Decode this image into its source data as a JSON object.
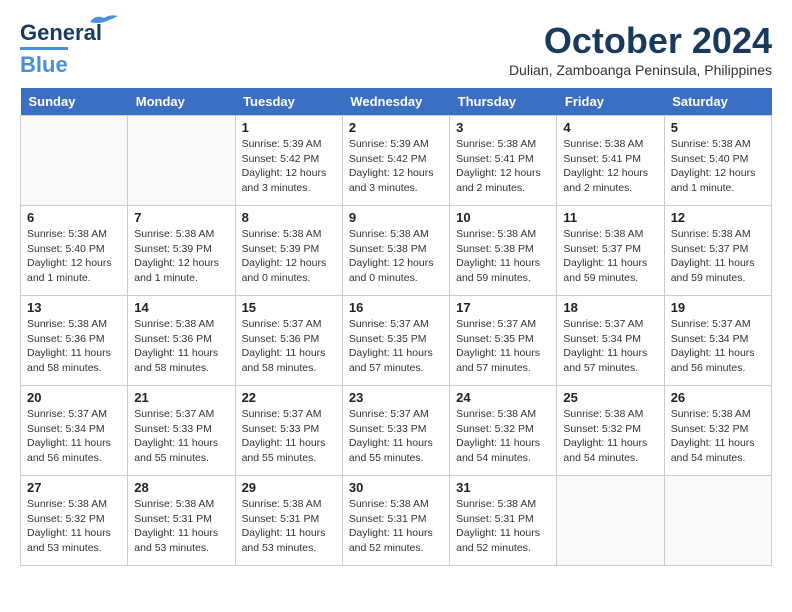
{
  "header": {
    "logo_line1": "General",
    "logo_line2": "Blue",
    "month": "October 2024",
    "location": "Dulian, Zamboanga Peninsula, Philippines"
  },
  "columns": [
    "Sunday",
    "Monday",
    "Tuesday",
    "Wednesday",
    "Thursday",
    "Friday",
    "Saturday"
  ],
  "weeks": [
    [
      {
        "day": "",
        "info": ""
      },
      {
        "day": "",
        "info": ""
      },
      {
        "day": "1",
        "info": "Sunrise: 5:39 AM\nSunset: 5:42 PM\nDaylight: 12 hours\nand 3 minutes."
      },
      {
        "day": "2",
        "info": "Sunrise: 5:39 AM\nSunset: 5:42 PM\nDaylight: 12 hours\nand 3 minutes."
      },
      {
        "day": "3",
        "info": "Sunrise: 5:38 AM\nSunset: 5:41 PM\nDaylight: 12 hours\nand 2 minutes."
      },
      {
        "day": "4",
        "info": "Sunrise: 5:38 AM\nSunset: 5:41 PM\nDaylight: 12 hours\nand 2 minutes."
      },
      {
        "day": "5",
        "info": "Sunrise: 5:38 AM\nSunset: 5:40 PM\nDaylight: 12 hours\nand 1 minute."
      }
    ],
    [
      {
        "day": "6",
        "info": "Sunrise: 5:38 AM\nSunset: 5:40 PM\nDaylight: 12 hours\nand 1 minute."
      },
      {
        "day": "7",
        "info": "Sunrise: 5:38 AM\nSunset: 5:39 PM\nDaylight: 12 hours\nand 1 minute."
      },
      {
        "day": "8",
        "info": "Sunrise: 5:38 AM\nSunset: 5:39 PM\nDaylight: 12 hours\nand 0 minutes."
      },
      {
        "day": "9",
        "info": "Sunrise: 5:38 AM\nSunset: 5:38 PM\nDaylight: 12 hours\nand 0 minutes."
      },
      {
        "day": "10",
        "info": "Sunrise: 5:38 AM\nSunset: 5:38 PM\nDaylight: 11 hours\nand 59 minutes."
      },
      {
        "day": "11",
        "info": "Sunrise: 5:38 AM\nSunset: 5:37 PM\nDaylight: 11 hours\nand 59 minutes."
      },
      {
        "day": "12",
        "info": "Sunrise: 5:38 AM\nSunset: 5:37 PM\nDaylight: 11 hours\nand 59 minutes."
      }
    ],
    [
      {
        "day": "13",
        "info": "Sunrise: 5:38 AM\nSunset: 5:36 PM\nDaylight: 11 hours\nand 58 minutes."
      },
      {
        "day": "14",
        "info": "Sunrise: 5:38 AM\nSunset: 5:36 PM\nDaylight: 11 hours\nand 58 minutes."
      },
      {
        "day": "15",
        "info": "Sunrise: 5:37 AM\nSunset: 5:36 PM\nDaylight: 11 hours\nand 58 minutes."
      },
      {
        "day": "16",
        "info": "Sunrise: 5:37 AM\nSunset: 5:35 PM\nDaylight: 11 hours\nand 57 minutes."
      },
      {
        "day": "17",
        "info": "Sunrise: 5:37 AM\nSunset: 5:35 PM\nDaylight: 11 hours\nand 57 minutes."
      },
      {
        "day": "18",
        "info": "Sunrise: 5:37 AM\nSunset: 5:34 PM\nDaylight: 11 hours\nand 57 minutes."
      },
      {
        "day": "19",
        "info": "Sunrise: 5:37 AM\nSunset: 5:34 PM\nDaylight: 11 hours\nand 56 minutes."
      }
    ],
    [
      {
        "day": "20",
        "info": "Sunrise: 5:37 AM\nSunset: 5:34 PM\nDaylight: 11 hours\nand 56 minutes."
      },
      {
        "day": "21",
        "info": "Sunrise: 5:37 AM\nSunset: 5:33 PM\nDaylight: 11 hours\nand 55 minutes."
      },
      {
        "day": "22",
        "info": "Sunrise: 5:37 AM\nSunset: 5:33 PM\nDaylight: 11 hours\nand 55 minutes."
      },
      {
        "day": "23",
        "info": "Sunrise: 5:37 AM\nSunset: 5:33 PM\nDaylight: 11 hours\nand 55 minutes."
      },
      {
        "day": "24",
        "info": "Sunrise: 5:38 AM\nSunset: 5:32 PM\nDaylight: 11 hours\nand 54 minutes."
      },
      {
        "day": "25",
        "info": "Sunrise: 5:38 AM\nSunset: 5:32 PM\nDaylight: 11 hours\nand 54 minutes."
      },
      {
        "day": "26",
        "info": "Sunrise: 5:38 AM\nSunset: 5:32 PM\nDaylight: 11 hours\nand 54 minutes."
      }
    ],
    [
      {
        "day": "27",
        "info": "Sunrise: 5:38 AM\nSunset: 5:32 PM\nDaylight: 11 hours\nand 53 minutes."
      },
      {
        "day": "28",
        "info": "Sunrise: 5:38 AM\nSunset: 5:31 PM\nDaylight: 11 hours\nand 53 minutes."
      },
      {
        "day": "29",
        "info": "Sunrise: 5:38 AM\nSunset: 5:31 PM\nDaylight: 11 hours\nand 53 minutes."
      },
      {
        "day": "30",
        "info": "Sunrise: 5:38 AM\nSunset: 5:31 PM\nDaylight: 11 hours\nand 52 minutes."
      },
      {
        "day": "31",
        "info": "Sunrise: 5:38 AM\nSunset: 5:31 PM\nDaylight: 11 hours\nand 52 minutes."
      },
      {
        "day": "",
        "info": ""
      },
      {
        "day": "",
        "info": ""
      }
    ]
  ]
}
